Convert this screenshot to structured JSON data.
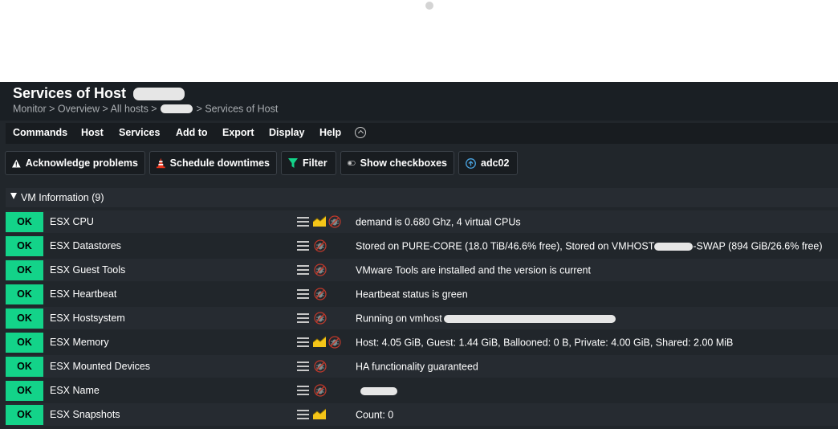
{
  "header": {
    "title": "Services of Host",
    "breadcrumb_prefix": "Monitor > Overview > All hosts >",
    "breadcrumb_suffix": "> Services of Host"
  },
  "menu": [
    "Commands",
    "Host",
    "Services",
    "Add to",
    "Export",
    "Display",
    "Help"
  ],
  "toolbar": {
    "acknowledge": "Acknowledge problems",
    "downtimes": "Schedule downtimes",
    "filter": "Filter",
    "checkboxes": "Show checkboxes",
    "site": "adc02"
  },
  "group": {
    "title": "VM Information (9)"
  },
  "rows": [
    {
      "state": "OK",
      "name": "ESX CPU",
      "graph": true,
      "summary": "demand is 0.680 Ghz, 4 virtual CPUs",
      "summary_tail": ""
    },
    {
      "state": "OK",
      "name": "ESX Datastores",
      "graph": false,
      "summary": "Stored on PURE-CORE (18.0 TiB/46.6% free), Stored on VMHOST",
      "summary_tail": "-SWAP (894 GiB/26.6% free)"
    },
    {
      "state": "OK",
      "name": "ESX Guest Tools",
      "graph": false,
      "summary": "VMware Tools are installed and the version is current",
      "summary_tail": ""
    },
    {
      "state": "OK",
      "name": "ESX Heartbeat",
      "graph": false,
      "summary": "Heartbeat status is green",
      "summary_tail": ""
    },
    {
      "state": "OK",
      "name": "ESX Hostsystem",
      "graph": false,
      "summary": "Running on vmhost",
      "summary_tail": ""
    },
    {
      "state": "OK",
      "name": "ESX Memory",
      "graph": true,
      "summary": "Host: 4.05 GiB, Guest: 1.44 GiB, Ballooned: 0 B, Private: 4.00 GiB, Shared: 2.00 MiB",
      "summary_tail": ""
    },
    {
      "state": "OK",
      "name": "ESX Mounted Devices",
      "graph": false,
      "summary": "HA functionality guaranteed",
      "summary_tail": ""
    },
    {
      "state": "OK",
      "name": "ESX Name",
      "graph": false,
      "summary": "",
      "summary_tail": ""
    },
    {
      "state": "OK",
      "name": "ESX Snapshots",
      "graph": true,
      "summary": "Count: 0",
      "summary_tail": ""
    }
  ],
  "colors": {
    "ok": "#13d389",
    "background": "#21262b",
    "graph_icon": "#f5c518"
  }
}
